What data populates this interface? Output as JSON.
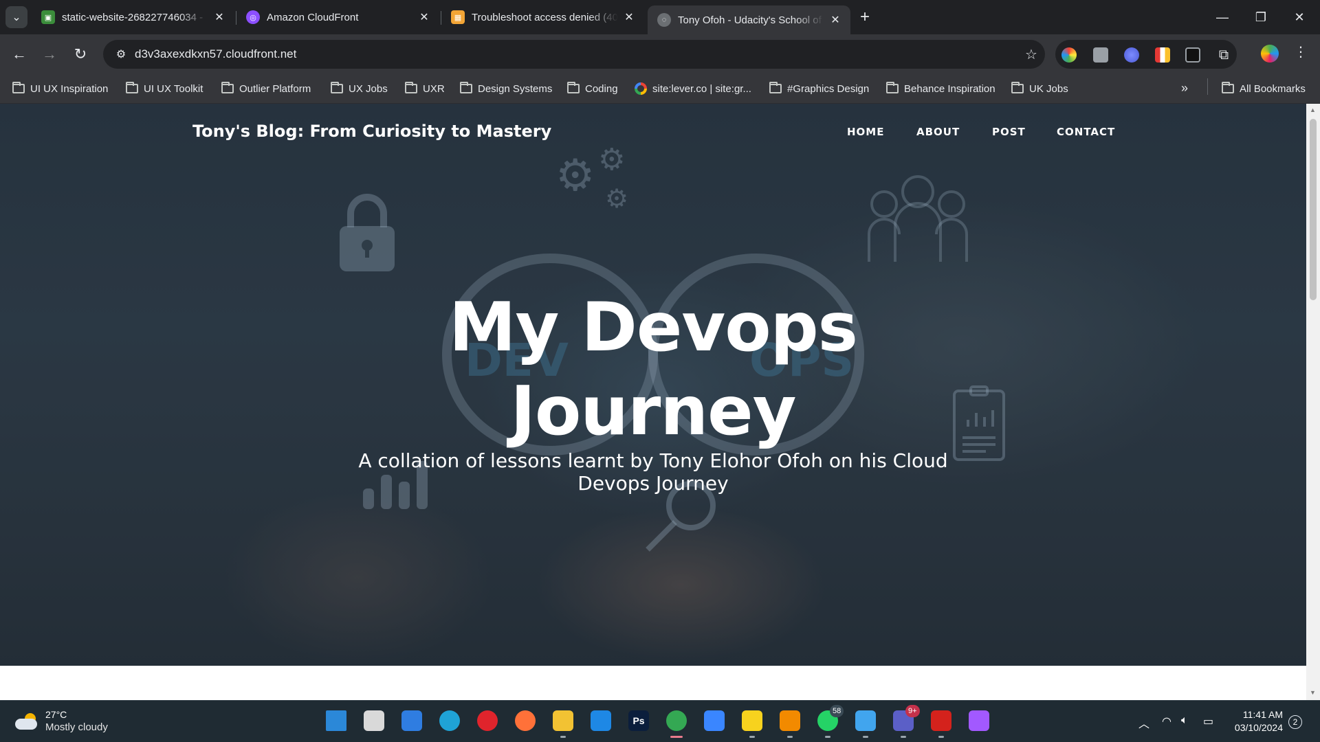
{
  "browser": {
    "tabs": [
      {
        "title": "static-website-268227746034 -",
        "favicon": "s3-bucket-icon",
        "color": "#3b8d3b"
      },
      {
        "title": "Amazon CloudFront",
        "favicon": "cloudfront-icon",
        "color": "#8c4fff"
      },
      {
        "title": "Troubleshoot access denied (40",
        "favicon": "aws-box-icon",
        "color": "#f2a536"
      },
      {
        "title": "Tony Ofoh - Udacity's School of",
        "favicon": "globe-icon",
        "color": "#6b6f73"
      }
    ],
    "active_tab_index": 3,
    "url": "d3v3axexdkxn57.cloudfront.net",
    "bookmarks": [
      {
        "label": "UI UX Inspiration",
        "type": "folder"
      },
      {
        "label": "UI UX Toolkit",
        "type": "folder"
      },
      {
        "label": "Outlier Platform",
        "type": "folder"
      },
      {
        "label": "UX Jobs",
        "type": "folder"
      },
      {
        "label": "UXR",
        "type": "folder"
      },
      {
        "label": "Design Systems",
        "type": "folder"
      },
      {
        "label": "Coding",
        "type": "folder"
      },
      {
        "label": "site:lever.co | site:gr...",
        "type": "google"
      },
      {
        "label": "#Graphics Design",
        "type": "folder"
      },
      {
        "label": "Behance Inspiration",
        "type": "folder"
      },
      {
        "label": "UK Jobs",
        "type": "folder"
      }
    ],
    "all_bookmarks": "All Bookmarks"
  },
  "page": {
    "brand": "Tony's Blog: From Curiosity to Mastery",
    "nav": [
      "HOME",
      "ABOUT",
      "POST",
      "CONTACT"
    ],
    "hero_title_line1": "My Devops",
    "hero_title_line2": "Journey",
    "hero_subtitle_line1": "A collation of lessons learnt by Tony Elohor Ofoh on his Cloud",
    "hero_subtitle_line2": "Devops Journey"
  },
  "taskbar": {
    "weather_temp": "27°C",
    "weather_desc": "Mostly cloudy",
    "apps": [
      {
        "name": "windows-start-icon",
        "color": "#2b88d8"
      },
      {
        "name": "task-view-icon",
        "color": "#d9d9d9"
      },
      {
        "name": "copilot-icon",
        "color": "#2f7de1"
      },
      {
        "name": "edge-icon",
        "color": "#1fa3d6"
      },
      {
        "name": "opera-icon",
        "color": "#e0242c"
      },
      {
        "name": "firefox-icon",
        "color": "#ff7139"
      },
      {
        "name": "file-explorer-icon",
        "color": "#f2c233"
      },
      {
        "name": "vscode-icon",
        "color": "#1e88e5"
      },
      {
        "name": "photoshop-icon",
        "color": "#0b1e3c",
        "label": "Ps"
      },
      {
        "name": "chrome-icon",
        "color": "#34a853"
      },
      {
        "name": "todo-icon",
        "color": "#3a86ff"
      },
      {
        "name": "sticky-notes-icon",
        "color": "#f7d21e"
      },
      {
        "name": "vlc-icon",
        "color": "#f28a00"
      },
      {
        "name": "whatsapp-icon",
        "color": "#25d366",
        "badge": "58"
      },
      {
        "name": "notepad-icon",
        "color": "#41a5ee"
      },
      {
        "name": "teams-icon",
        "color": "#5b5fc7",
        "badge": "9+"
      },
      {
        "name": "acrobat-icon",
        "color": "#d4221c"
      },
      {
        "name": "figma-icon",
        "color": "#a259ff"
      }
    ],
    "time": "11:41 AM",
    "date": "03/10/2024",
    "notifications": "2"
  }
}
